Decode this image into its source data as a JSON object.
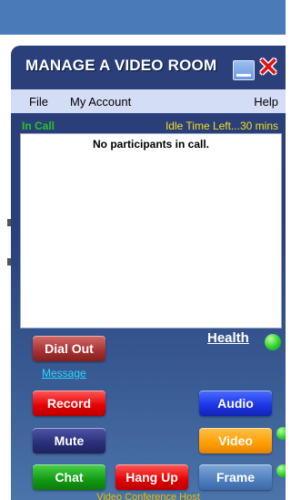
{
  "window": {
    "title": "MANAGE A VIDEO ROOM"
  },
  "menu": {
    "file": "File",
    "account": "My Account",
    "help": "Help"
  },
  "status": {
    "in_call": "In Call",
    "idle_time": "Idle Time Left...30 mins"
  },
  "participants": {
    "empty_text": "No participants in call."
  },
  "health": {
    "label": "Health",
    "status_color": "#2fd12f"
  },
  "buttons": {
    "dial_out": "Dial Out",
    "message": "Message",
    "record": "Record",
    "audio": "Audio",
    "mute": "Mute",
    "video": "Video",
    "chat": "Chat",
    "hang_up": "Hang Up",
    "frame": "Frame"
  },
  "footer": {
    "label": "Video Conference Host"
  },
  "colors": {
    "titlebar": "#2b3f7a",
    "menubar": "#d4ddf6",
    "in_call": "#23c623",
    "idle_time": "#f0e020",
    "close": "#e01515"
  },
  "icons": {
    "minimize": "minimize-icon",
    "close": "close-icon",
    "health_indicator": "status-dot-icon"
  }
}
